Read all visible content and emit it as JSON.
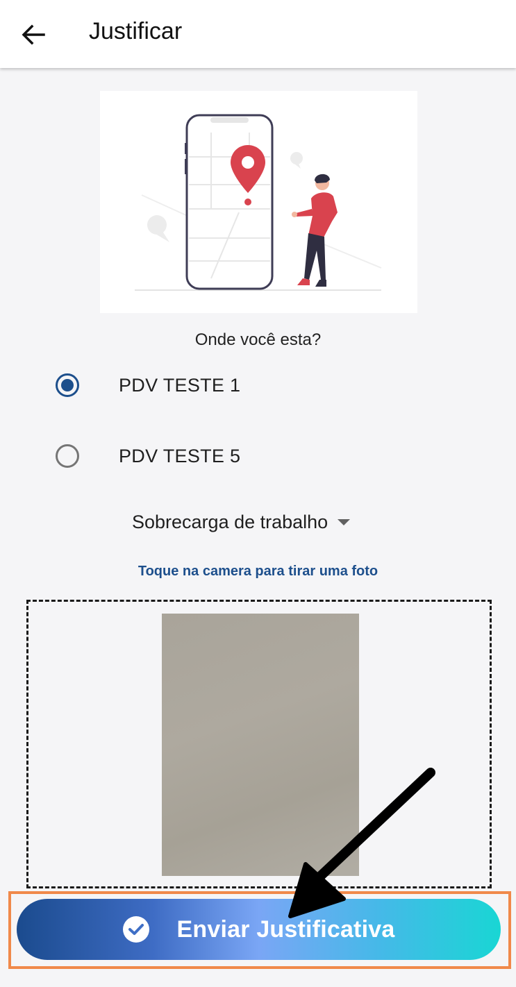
{
  "header": {
    "title": "Justificar",
    "back_icon": "arrow-left-icon"
  },
  "illustration": {
    "icon": "location-pin-phone-illustration",
    "colors": {
      "accent": "#d9434e",
      "outline": "#3f3d56"
    }
  },
  "location_question": "Onde você esta?",
  "locations": [
    {
      "label": "PDV TESTE 1",
      "selected": true
    },
    {
      "label": "PDV TESTE 5",
      "selected": false
    }
  ],
  "reason_dropdown": {
    "selected": "Sobrecarga de trabalho",
    "caret_icon": "caret-down-icon"
  },
  "photo_hint": "Toque na camera para tirar uma foto",
  "photo": {
    "has_image": true
  },
  "submit": {
    "label": "Enviar Justificativa",
    "icon": "check-circle-icon"
  },
  "colors": {
    "primary": "#1d4f8c",
    "gradient_start": "#1b4b8e",
    "gradient_end": "#19d6d4",
    "highlight": "#f0894a"
  }
}
